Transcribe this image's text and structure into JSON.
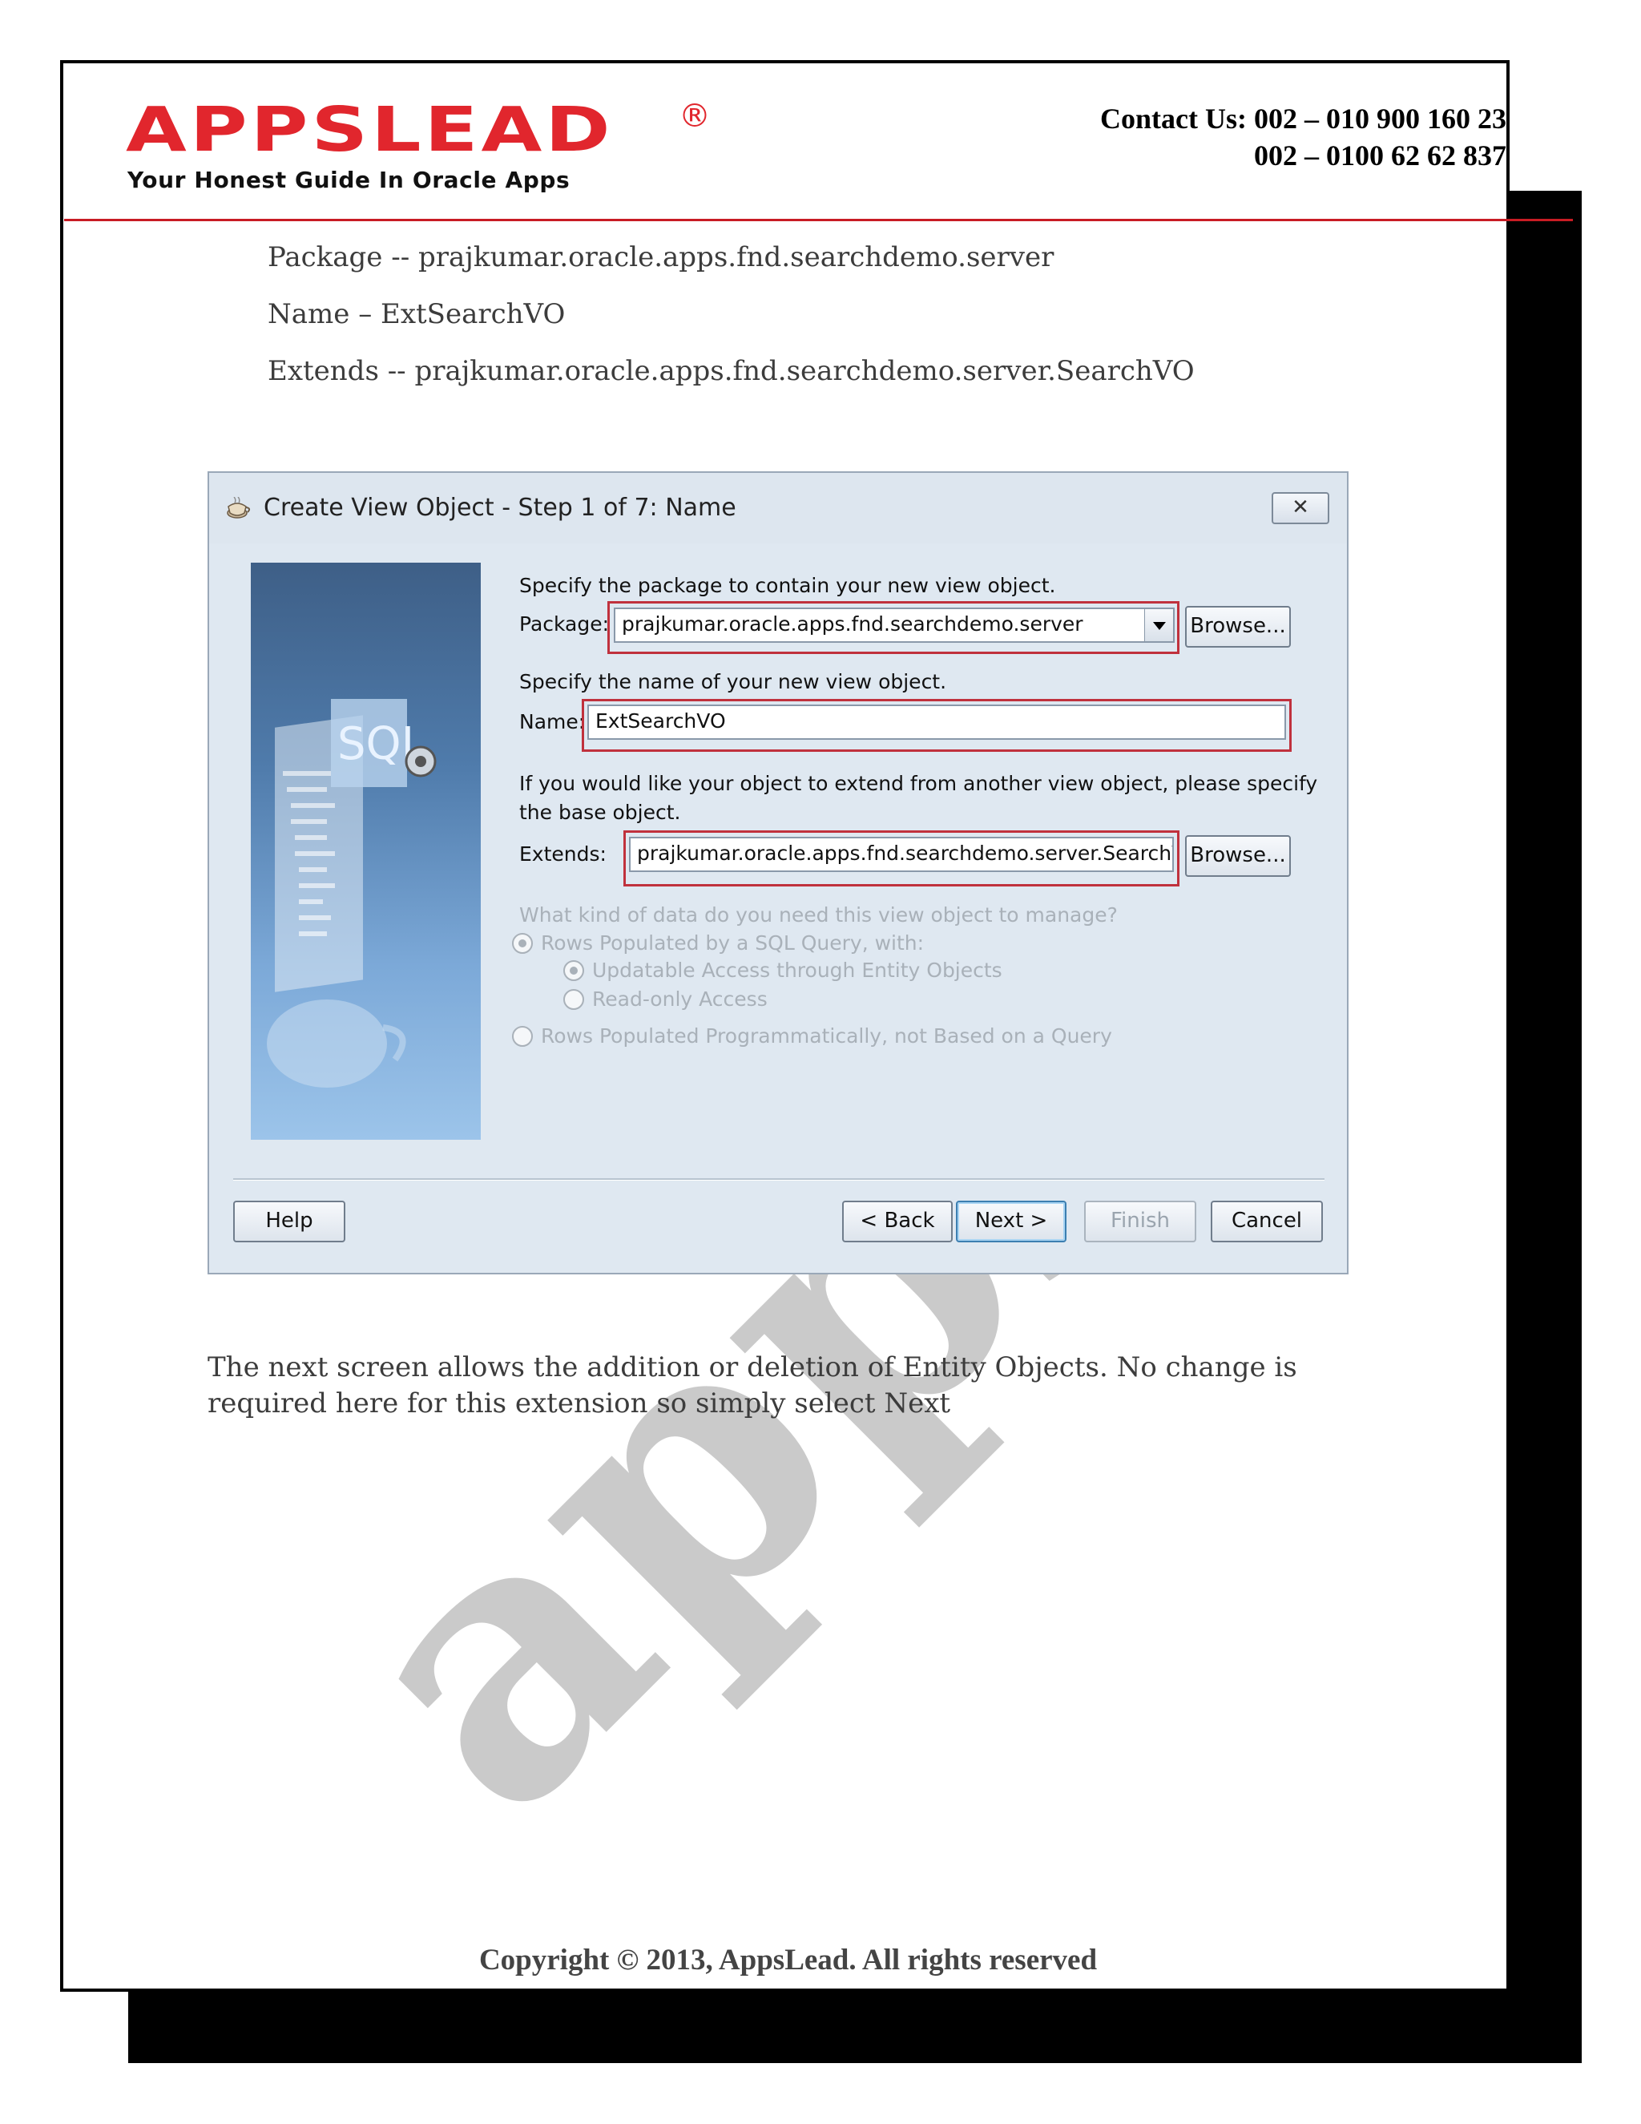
{
  "header": {
    "logo_text": "APPSLEAD",
    "logo_registered": "®",
    "tagline": "Your Honest Guide In Oracle Apps",
    "contact_line1": "Contact Us: 002 – 010 900 160 23",
    "contact_line2": "002 – 0100 62 62 837"
  },
  "body": {
    "line_package": "Package -- prajkumar.oracle.apps.fnd.searchdemo.server",
    "line_name": "Name – ExtSearchVO",
    "line_extends": "Extends -- prajkumar.oracle.apps.fnd.searchdemo.server.SearchVO",
    "paragraph": "The next screen allows the addition or deletion of Entity Objects. No change is required here for this extension so simply select Next"
  },
  "watermark": "apps",
  "dialog": {
    "title": "Create View Object - Step 1 of 7: Name",
    "close_label": "✕",
    "package_prompt": "Specify the package to contain your new view object.",
    "package_label": "Package:",
    "package_value": "prajkumar.oracle.apps.fnd.searchdemo.server",
    "browse_label": "Browse...",
    "name_prompt": "Specify the name of your new view object.",
    "name_label": "Name:",
    "name_value": "ExtSearchVO",
    "extends_prompt_1": "If you would like your object to extend from another view object, please specify",
    "extends_prompt_2": "the base object.",
    "extends_label": "Extends:",
    "extends_value": "prajkumar.oracle.apps.fnd.searchdemo.server.SearchVO",
    "data_kind_prompt": "What kind of data do you need this view object to manage?",
    "opt_sql": "Rows Populated by a SQL Query, with:",
    "opt_updatable": "Updatable Access through Entity Objects",
    "opt_readonly": "Read-only Access",
    "opt_programmatic": "Rows Populated Programmatically, not Based on a Query",
    "side_image_text": "SQL",
    "help": "Help",
    "back": "< Back",
    "next": "Next >",
    "finish": "Finish",
    "cancel": "Cancel"
  },
  "footer": {
    "copyright": "Copyright © 2013, AppsLead. All rights reserved"
  }
}
